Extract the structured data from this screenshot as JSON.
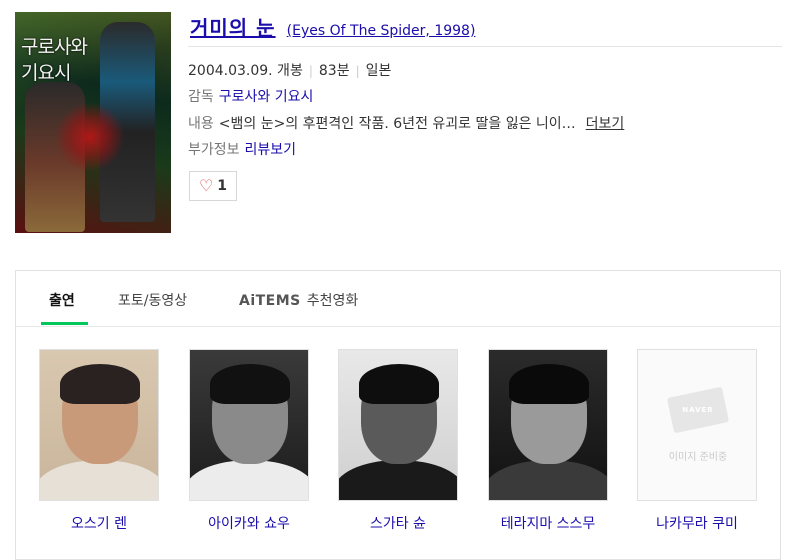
{
  "movie": {
    "poster_title": "구로사와 기요시",
    "title_ko": "거미의 눈",
    "title_en": "(Eyes Of The Spider, 1998)",
    "release": "2004.03.09. 개봉",
    "runtime": "83분",
    "country": "일본",
    "director_label": "감독",
    "director": "구로사와 기요시",
    "content_label": "내용",
    "content": "<뱀의 눈>의 후편격인 작품. 6년전 유괴로 딸을 잃은 니이…",
    "more_label": "더보기",
    "extra_label": "부가정보",
    "extra_link": "리뷰보기",
    "like_count": "1"
  },
  "tabs": [
    {
      "label": "출연",
      "active": true
    },
    {
      "label": "포토/동영상",
      "active": false
    },
    {
      "brand": "AiTEMS",
      "label": "추천영화",
      "active": false
    }
  ],
  "cast": [
    {
      "name": "오스기 렌",
      "has_image": true
    },
    {
      "name": "아이카와 쇼우",
      "has_image": true
    },
    {
      "name": "스가타 슌",
      "has_image": true
    },
    {
      "name": "테라지마 스스무",
      "has_image": true
    },
    {
      "name": "나카무라 쿠미",
      "has_image": false,
      "placeholder_logo": "NAVER",
      "placeholder_text": "이미지 준비중"
    }
  ],
  "colors": {
    "link": "#1a0dab",
    "accent": "#03c75a",
    "heart": "#e0474c"
  }
}
